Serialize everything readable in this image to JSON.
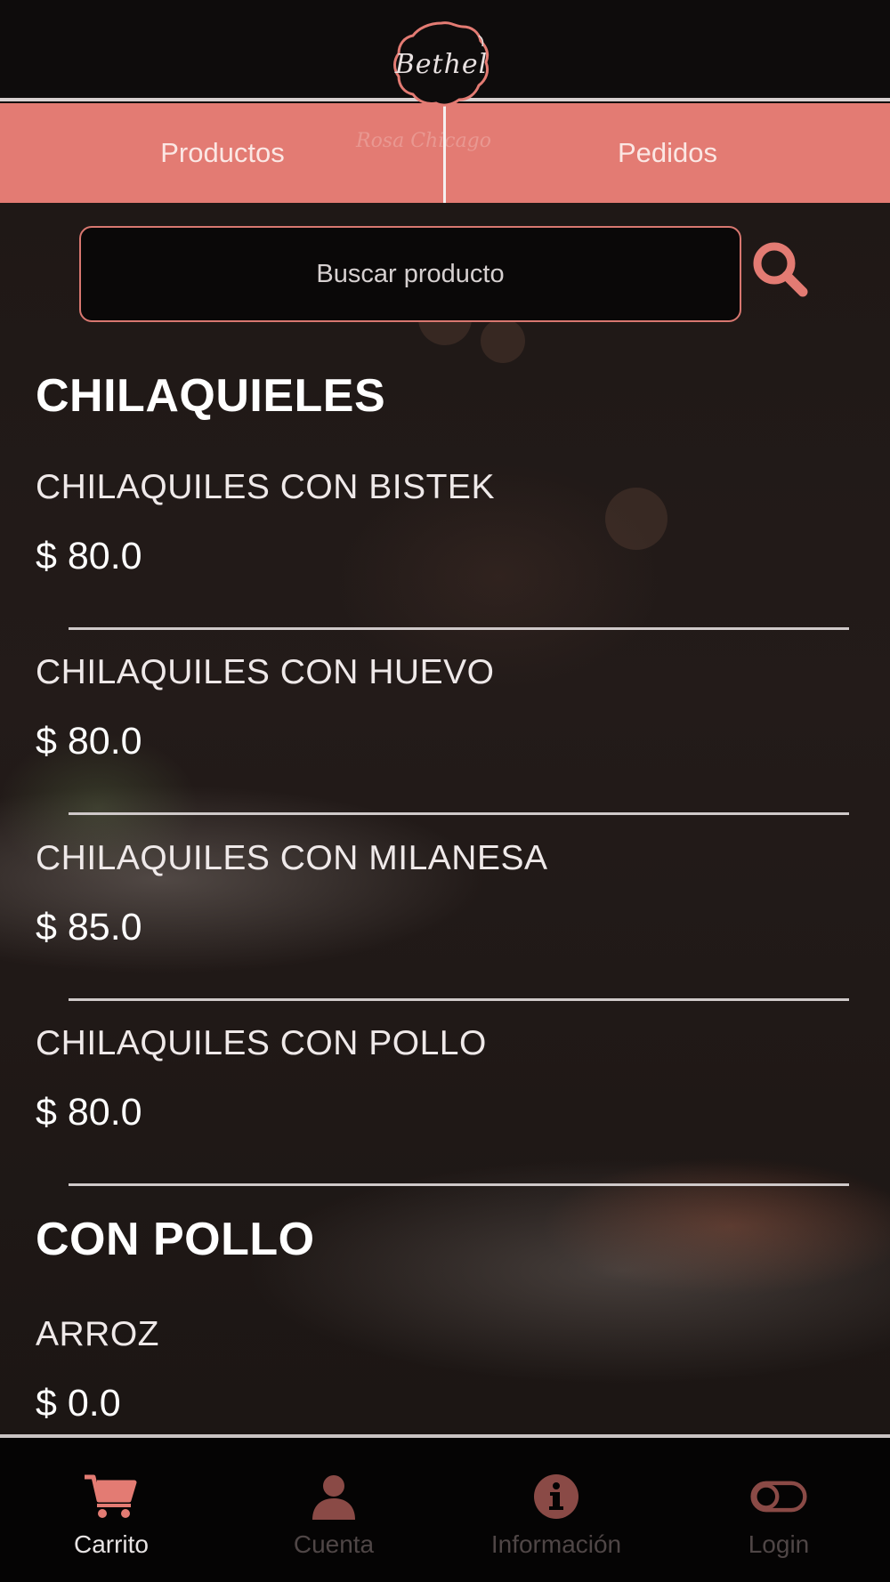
{
  "header": {
    "logo_text": "Bethel",
    "logo_subtext": "Rosa Chicago",
    "tabs": [
      {
        "label": "Productos"
      },
      {
        "label": "Pedidos"
      }
    ]
  },
  "search": {
    "placeholder": "Buscar producto",
    "icon": "search-icon"
  },
  "categories": [
    {
      "name": "CHILAQUIELES",
      "products": [
        {
          "name": "CHILAQUILES CON BISTEK",
          "price": "$ 80.0"
        },
        {
          "name": "CHILAQUILES CON HUEVO",
          "price": "$ 80.0"
        },
        {
          "name": "CHILAQUILES CON MILANESA",
          "price": "$ 85.0"
        },
        {
          "name": "CHILAQUILES CON POLLO",
          "price": "$ 80.0"
        }
      ]
    },
    {
      "name": "CON POLLO",
      "products": [
        {
          "name": "ARROZ",
          "price": "$ 0.0"
        }
      ]
    }
  ],
  "bottom_nav": [
    {
      "label": "Carrito",
      "icon": "cart-icon",
      "active": true
    },
    {
      "label": "Cuenta",
      "icon": "user-icon",
      "active": false
    },
    {
      "label": "Información",
      "icon": "info-icon",
      "active": false
    },
    {
      "label": "Login",
      "icon": "toggle-icon",
      "active": false
    }
  ],
  "colors": {
    "accent": "#e37b73",
    "background": "#0e0c0c",
    "icon_dim": "#8a4a46"
  }
}
